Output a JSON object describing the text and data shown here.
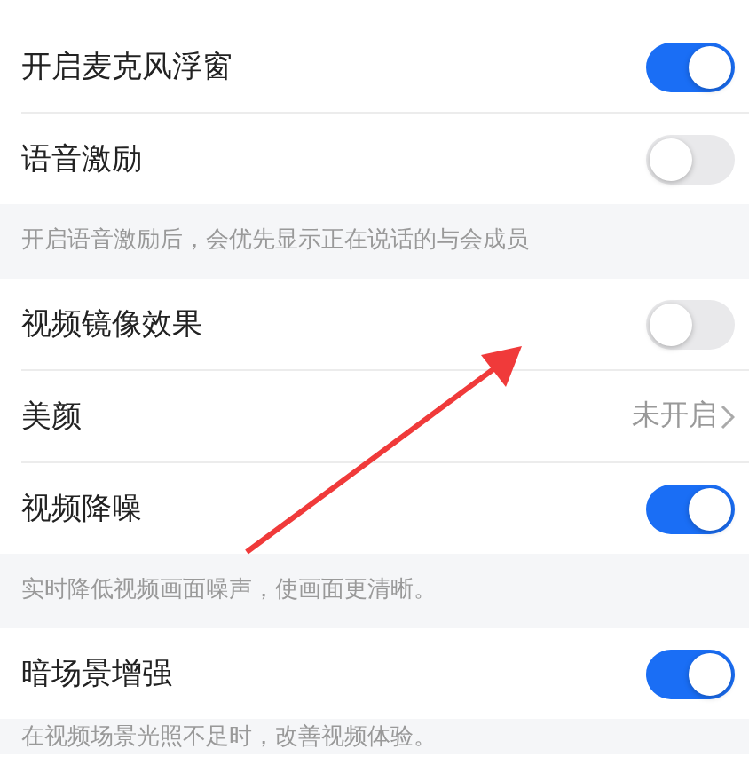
{
  "settings": [
    {
      "kind": "switch",
      "label": "开启麦克风浮窗",
      "on": true
    },
    {
      "kind": "switch",
      "label": "语音激励",
      "on": false
    },
    {
      "kind": "hint",
      "text": "开启语音激励后，会优先显示正在说话的与会成员"
    },
    {
      "kind": "switch",
      "label": "视频镜像效果",
      "on": false
    },
    {
      "kind": "link",
      "label": "美颜",
      "value": "未开启"
    },
    {
      "kind": "switch",
      "label": "视频降噪",
      "on": true
    },
    {
      "kind": "hint",
      "text": "实时降低视频画面噪声，使画面更清晰。"
    },
    {
      "kind": "switch",
      "label": "暗场景增强",
      "on": true
    },
    {
      "kind": "hint",
      "text": "在视频场景光照不足时，改善视频体验。"
    }
  ]
}
